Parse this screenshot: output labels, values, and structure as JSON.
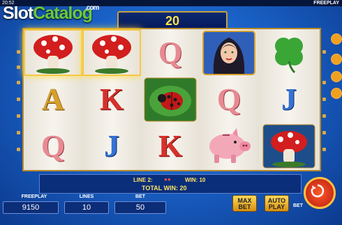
{
  "topbar": {
    "clock": "20:52",
    "mode": "FREEPLAY"
  },
  "logo": {
    "part1": "Slot",
    "part2": "Catalog",
    "suffix": ".com"
  },
  "win_display": {
    "value": "20"
  },
  "reels": [
    [
      "mushroom",
      "A",
      "Q"
    ],
    [
      "mushroom",
      "K",
      "J"
    ],
    [
      "Q",
      "ladybug",
      "K"
    ],
    [
      "woman",
      "Q",
      "piggy-bank"
    ],
    [
      "clover",
      "J",
      "mushroom"
    ]
  ],
  "info": {
    "line_label": "LINE 2:",
    "win_label": "WIN: 10",
    "total_label": "TOTAL WIN: 20"
  },
  "bottom": {
    "freeplay": {
      "label": "FREEPLAY",
      "value": "9150"
    },
    "lines": {
      "label": "LINES",
      "value": "10"
    },
    "bet": {
      "label": "BET",
      "value": "50"
    }
  },
  "buttons": {
    "maxbet": "MAX BET",
    "autoplay": "AUTO PLAY",
    "bet_minus": "BET"
  },
  "colors": {
    "accent": "#ffe14a",
    "frame": "#c8a040"
  }
}
